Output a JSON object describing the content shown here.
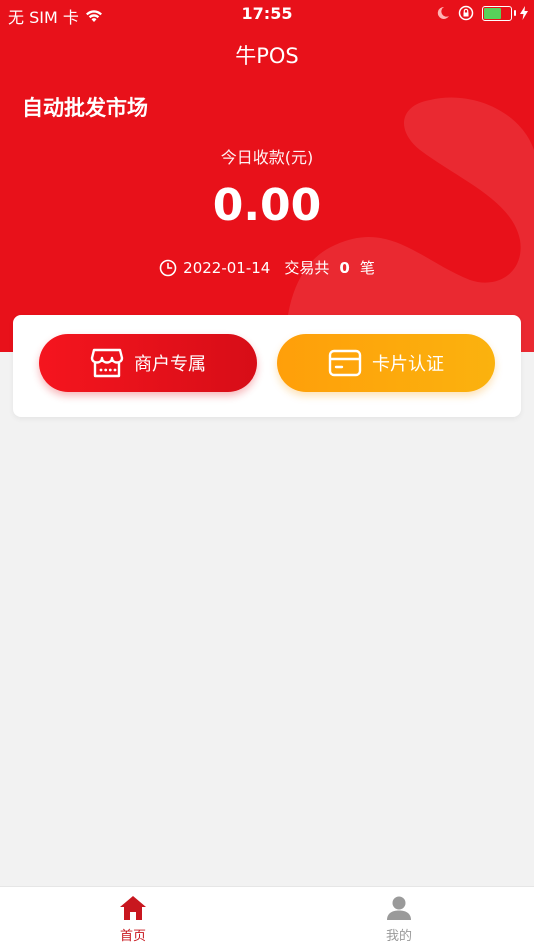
{
  "status_bar": {
    "carrier": "无 SIM 卡",
    "time": "17:55"
  },
  "header": {
    "app_title": "牛POS",
    "merchant_name": "自动批发市场"
  },
  "summary": {
    "today_label": "今日收款(元)",
    "amount": "0.00",
    "date": "2022-01-14",
    "trade_prefix": "交易共",
    "trade_count": "0",
    "trade_suffix": "笔"
  },
  "actions": {
    "merchant_label": "商户专属",
    "card_label": "卡片认证"
  },
  "tabs": [
    {
      "label": "首页",
      "icon": "home-icon",
      "active": true
    },
    {
      "label": "我的",
      "icon": "user-icon",
      "active": false
    }
  ],
  "colors": {
    "primary_red": "#e8111a",
    "accent_orange": "#fdaa0c",
    "tab_active": "#c8171f",
    "tab_inactive": "#9a9a9a"
  }
}
